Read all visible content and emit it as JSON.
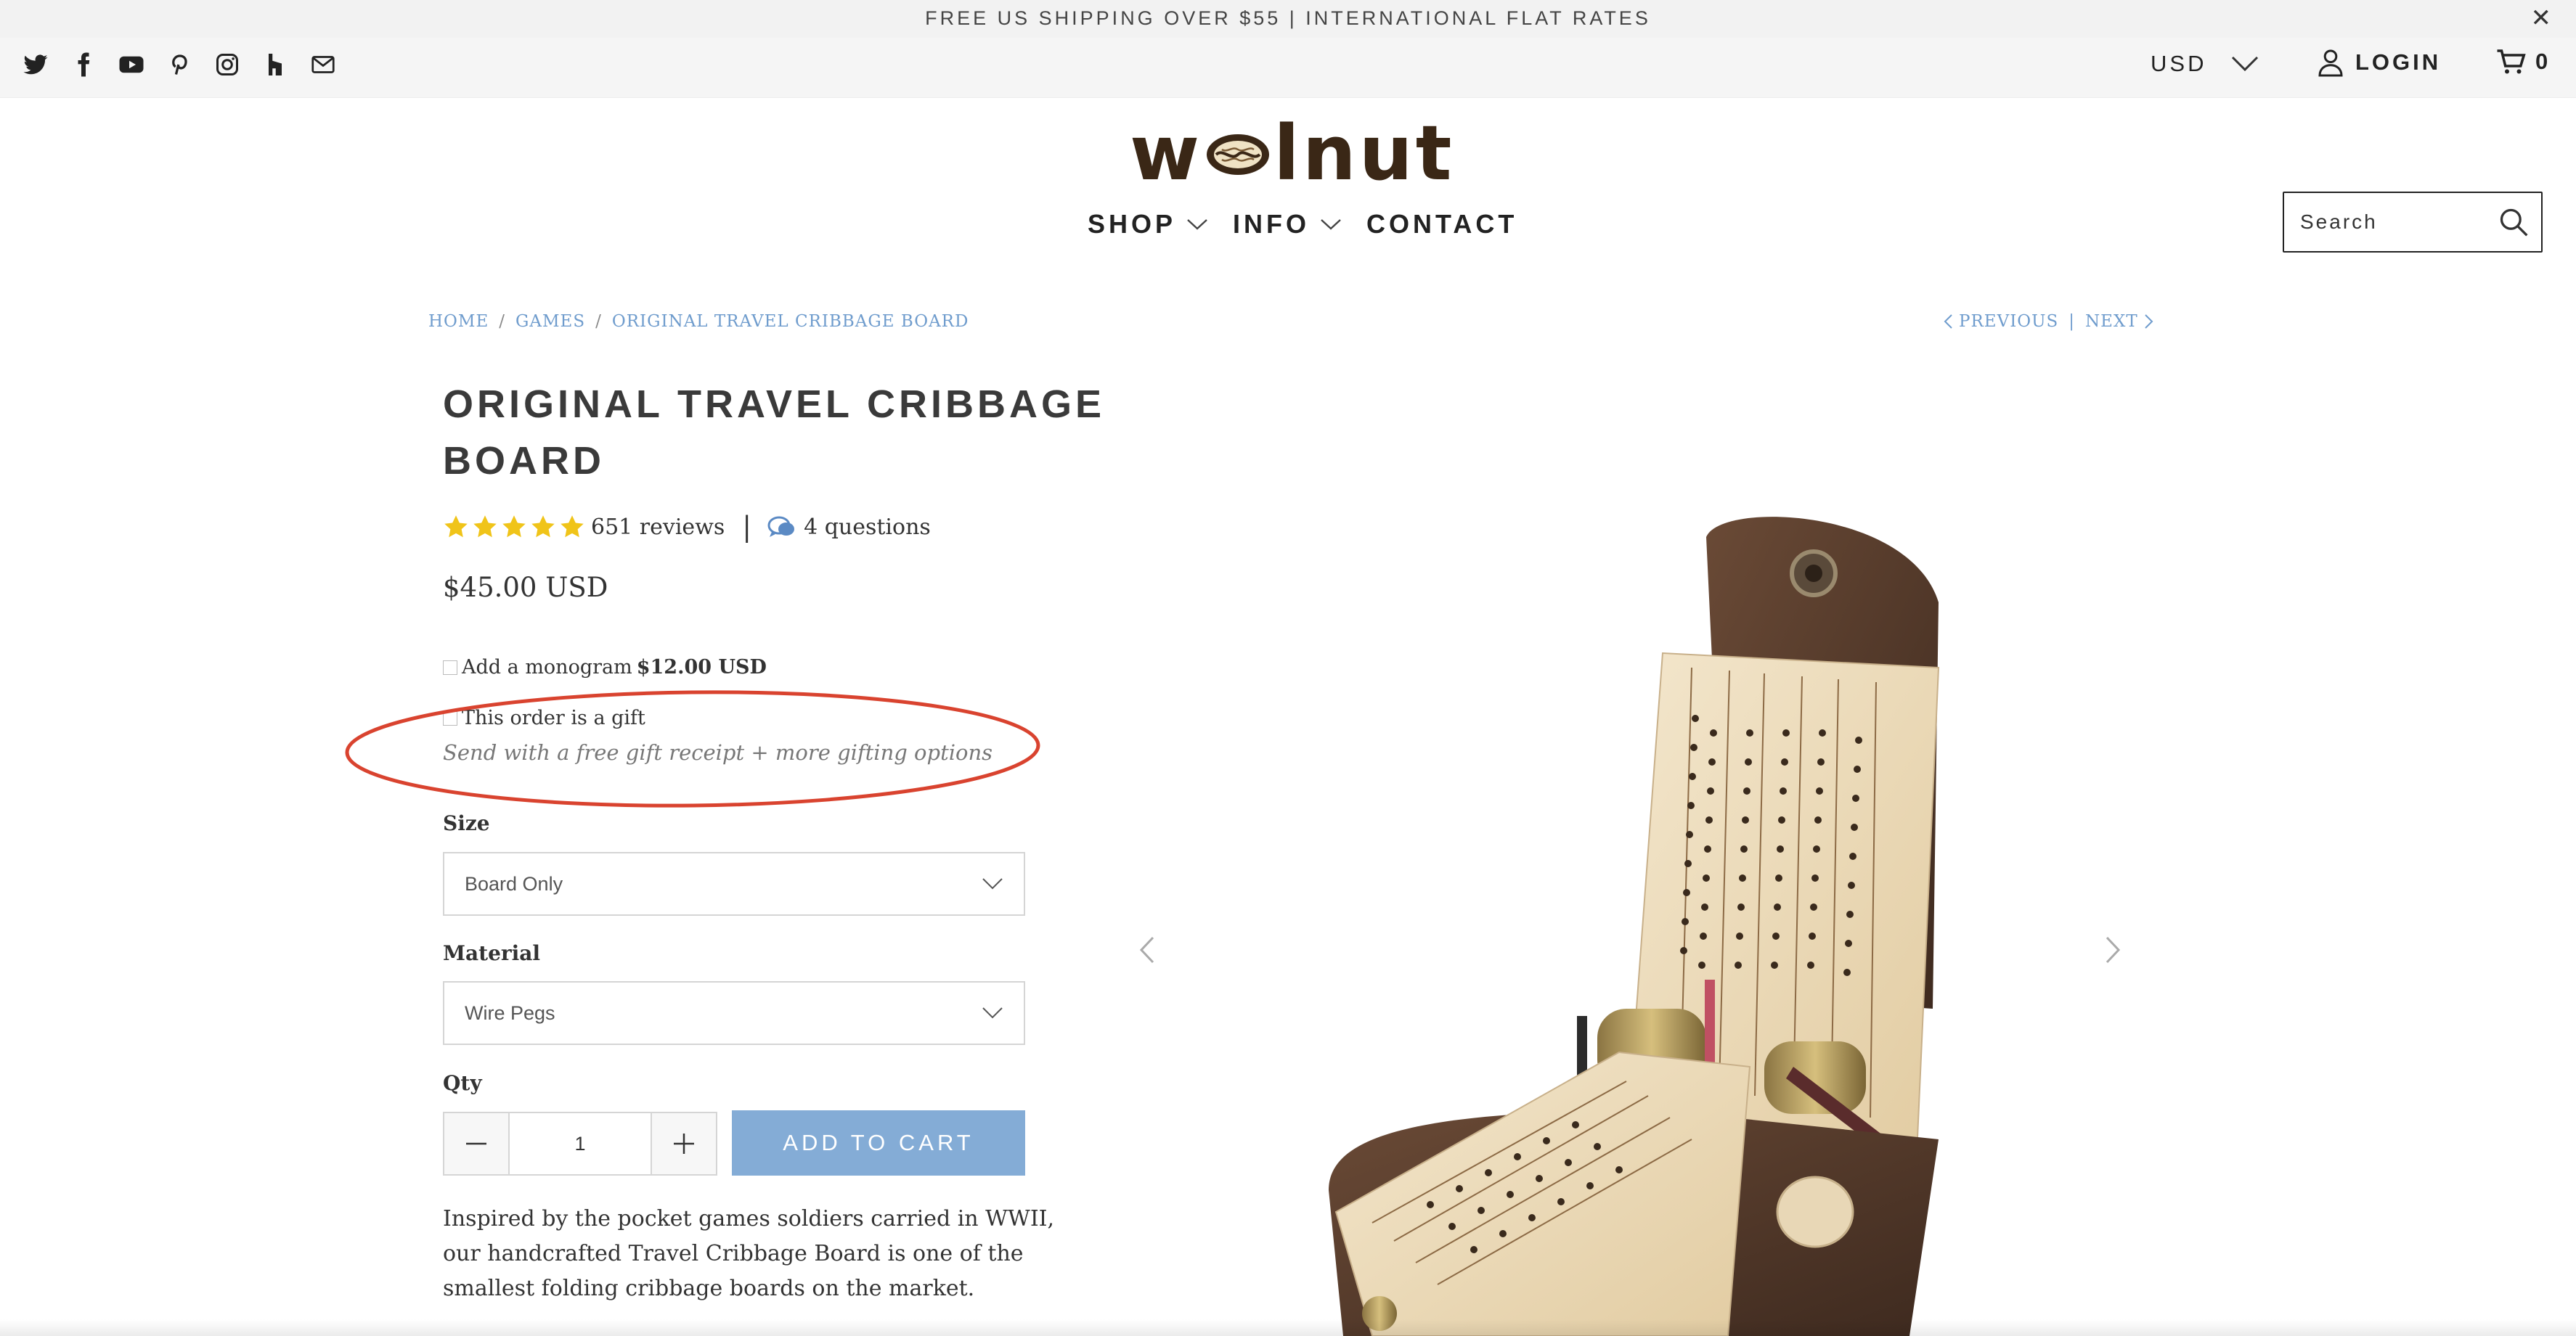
{
  "announcement": {
    "text": "FREE US SHIPPING OVER $55 | INTERNATIONAL FLAT RATES",
    "close": "✕"
  },
  "topbar": {
    "social": [
      "twitter-icon",
      "facebook-icon",
      "youtube-icon",
      "pinterest-icon",
      "instagram-icon",
      "houzz-icon",
      "email-icon"
    ],
    "currency": "USD",
    "login": "LOGIN",
    "cart_count": "0"
  },
  "brand": {
    "pre": "w",
    "post": "lnut",
    "color": "#3a2716"
  },
  "nav": {
    "shop": "SHOP",
    "info": "INFO",
    "contact": "CONTACT"
  },
  "search": {
    "placeholder": "Search"
  },
  "breadcrumb": {
    "home": "HOME",
    "games": "GAMES",
    "current": "ORIGINAL TRAVEL CRIBBAGE BOARD",
    "sep": "/"
  },
  "pager": {
    "previous": "PREVIOUS",
    "sep": "|",
    "next": "NEXT"
  },
  "product": {
    "title": "ORIGINAL TRAVEL CRIBBAGE BOARD",
    "rating": 5,
    "reviews": "651 reviews",
    "rating_sep": "|",
    "questions": "4 questions",
    "price": "$45.00 USD",
    "monogram_label": "Add a monogram",
    "monogram_price": "$12.00 USD",
    "gift_label": "This order is a gift",
    "gift_note": "Send with a free gift receipt + more gifting options",
    "size_label": "Size",
    "size_value": "Board Only",
    "material_label": "Material",
    "material_value": "Wire Pegs",
    "qty_label": "Qty",
    "qty_value": "1",
    "add_to_cart": "ADD TO CART",
    "description": "Inspired by the pocket games soldiers carried in WWII, our handcrafted Travel Cribbage Board is one of the smallest folding cribbage boards on the market."
  },
  "colors": {
    "accent": "#84acd6",
    "link": "#6f9ccd",
    "star": "#f0c419",
    "annotation": "#d9432f"
  }
}
